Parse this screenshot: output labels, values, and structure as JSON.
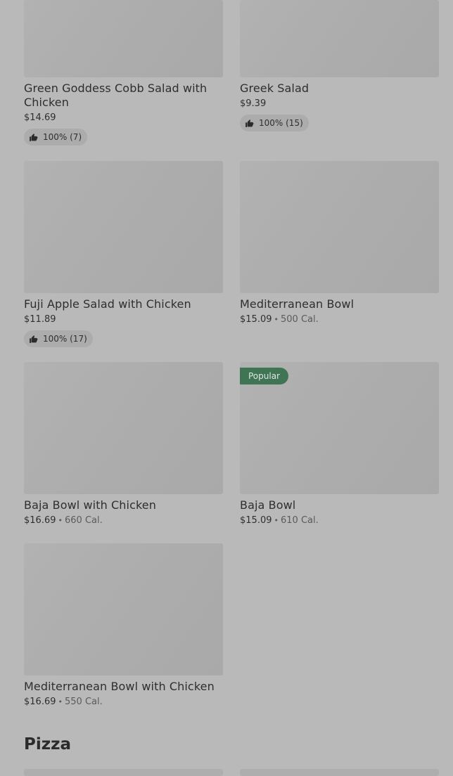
{
  "items": [
    {
      "name": "Green Goddess Cobb Salad with Chicken",
      "price": "$14.69",
      "rating": "100% (7)"
    },
    {
      "name": "Greek Salad",
      "price": "$9.39",
      "rating": "100% (15)"
    },
    {
      "name": "Fuji Apple Salad with Chicken",
      "price": "$11.89",
      "rating": "100% (17)"
    },
    {
      "name": "Mediterranean Bowl",
      "price": "$15.09",
      "calories": "500 Cal."
    },
    {
      "name": "Baja Bowl with Chicken",
      "price": "$16.69",
      "calories": "660 Cal."
    },
    {
      "name": "Baja Bowl",
      "price": "$15.09",
      "calories": "610 Cal.",
      "badge": "Popular"
    },
    {
      "name": "Mediterranean Bowl with Chicken",
      "price": "$16.69",
      "calories": "550 Cal."
    }
  ],
  "separator": "•",
  "section": {
    "title": "Pizza"
  },
  "icons": {
    "rating": "thumbs-up-icon"
  },
  "colors": {
    "badge": "#3f7554"
  }
}
